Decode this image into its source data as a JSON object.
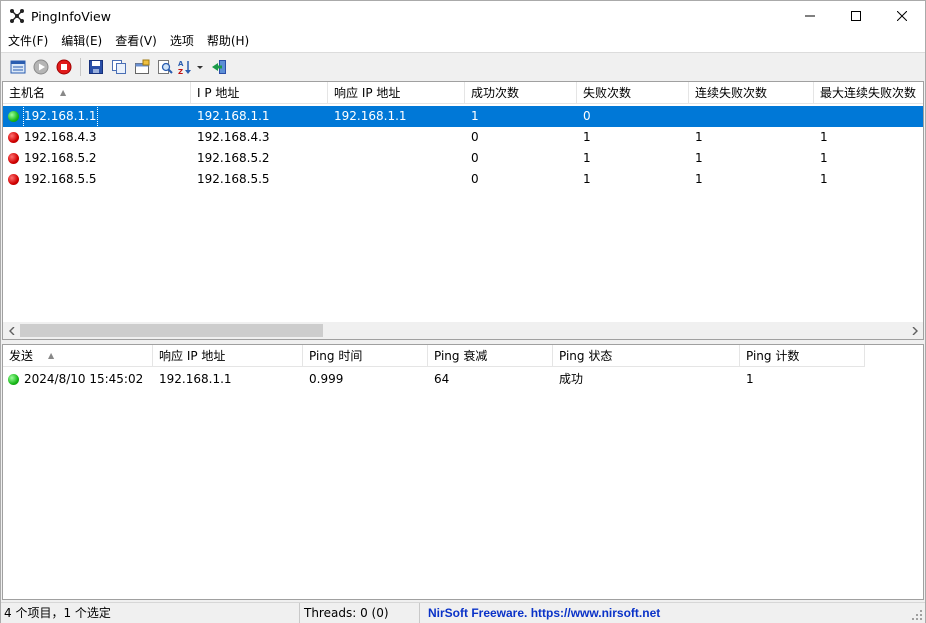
{
  "window": {
    "title": "PingInfoView"
  },
  "menu": [
    "文件(F)",
    "编辑(E)",
    "查看(V)",
    "选项",
    "帮助(H)"
  ],
  "toolbar": [
    "options-icon",
    "start-ping-icon",
    "stop-ping-icon",
    "save-icon",
    "copy-icon",
    "properties-icon",
    "find-icon",
    "sort-icon",
    "exit-icon"
  ],
  "hosts": {
    "columns": [
      "主机名",
      "I P 地址",
      "响应 IP 地址",
      "成功次数",
      "失败次数",
      "连续失败次数",
      "最大连续失败次数"
    ],
    "rows": [
      {
        "host": "192.168.1.1",
        "ip": "192.168.1.1",
        "reply_ip": "192.168.1.1",
        "success": "1",
        "failed": "0",
        "consecutive": "",
        "max_consecutive": "",
        "status": "green"
      },
      {
        "host": "192.168.4.3",
        "ip": "192.168.4.3",
        "reply_ip": "",
        "success": "0",
        "failed": "1",
        "consecutive": "1",
        "max_consecutive": "1",
        "status": "red"
      },
      {
        "host": "192.168.5.2",
        "ip": "192.168.5.2",
        "reply_ip": "",
        "success": "0",
        "failed": "1",
        "consecutive": "1",
        "max_consecutive": "1",
        "status": "red"
      },
      {
        "host": "192.168.5.5",
        "ip": "192.168.5.5",
        "reply_ip": "",
        "success": "0",
        "failed": "1",
        "consecutive": "1",
        "max_consecutive": "1",
        "status": "red"
      }
    ]
  },
  "pings": {
    "columns": [
      "发送",
      "响应 IP 地址",
      "Ping 时间",
      "Ping 衰减",
      "Ping 状态",
      "Ping 计数"
    ],
    "rows": [
      {
        "sent": "2024/8/10 15:45:02",
        "reply_ip": "192.168.1.1",
        "time": "0.999",
        "ttl": "64",
        "status": "成功",
        "count": "1",
        "dot": "green"
      }
    ]
  },
  "status": {
    "items": "4 个项目，1 个选定",
    "threads": "Threads: 0 (0)",
    "link": "NirSoft Freeware. https://www.nirsoft.net"
  }
}
